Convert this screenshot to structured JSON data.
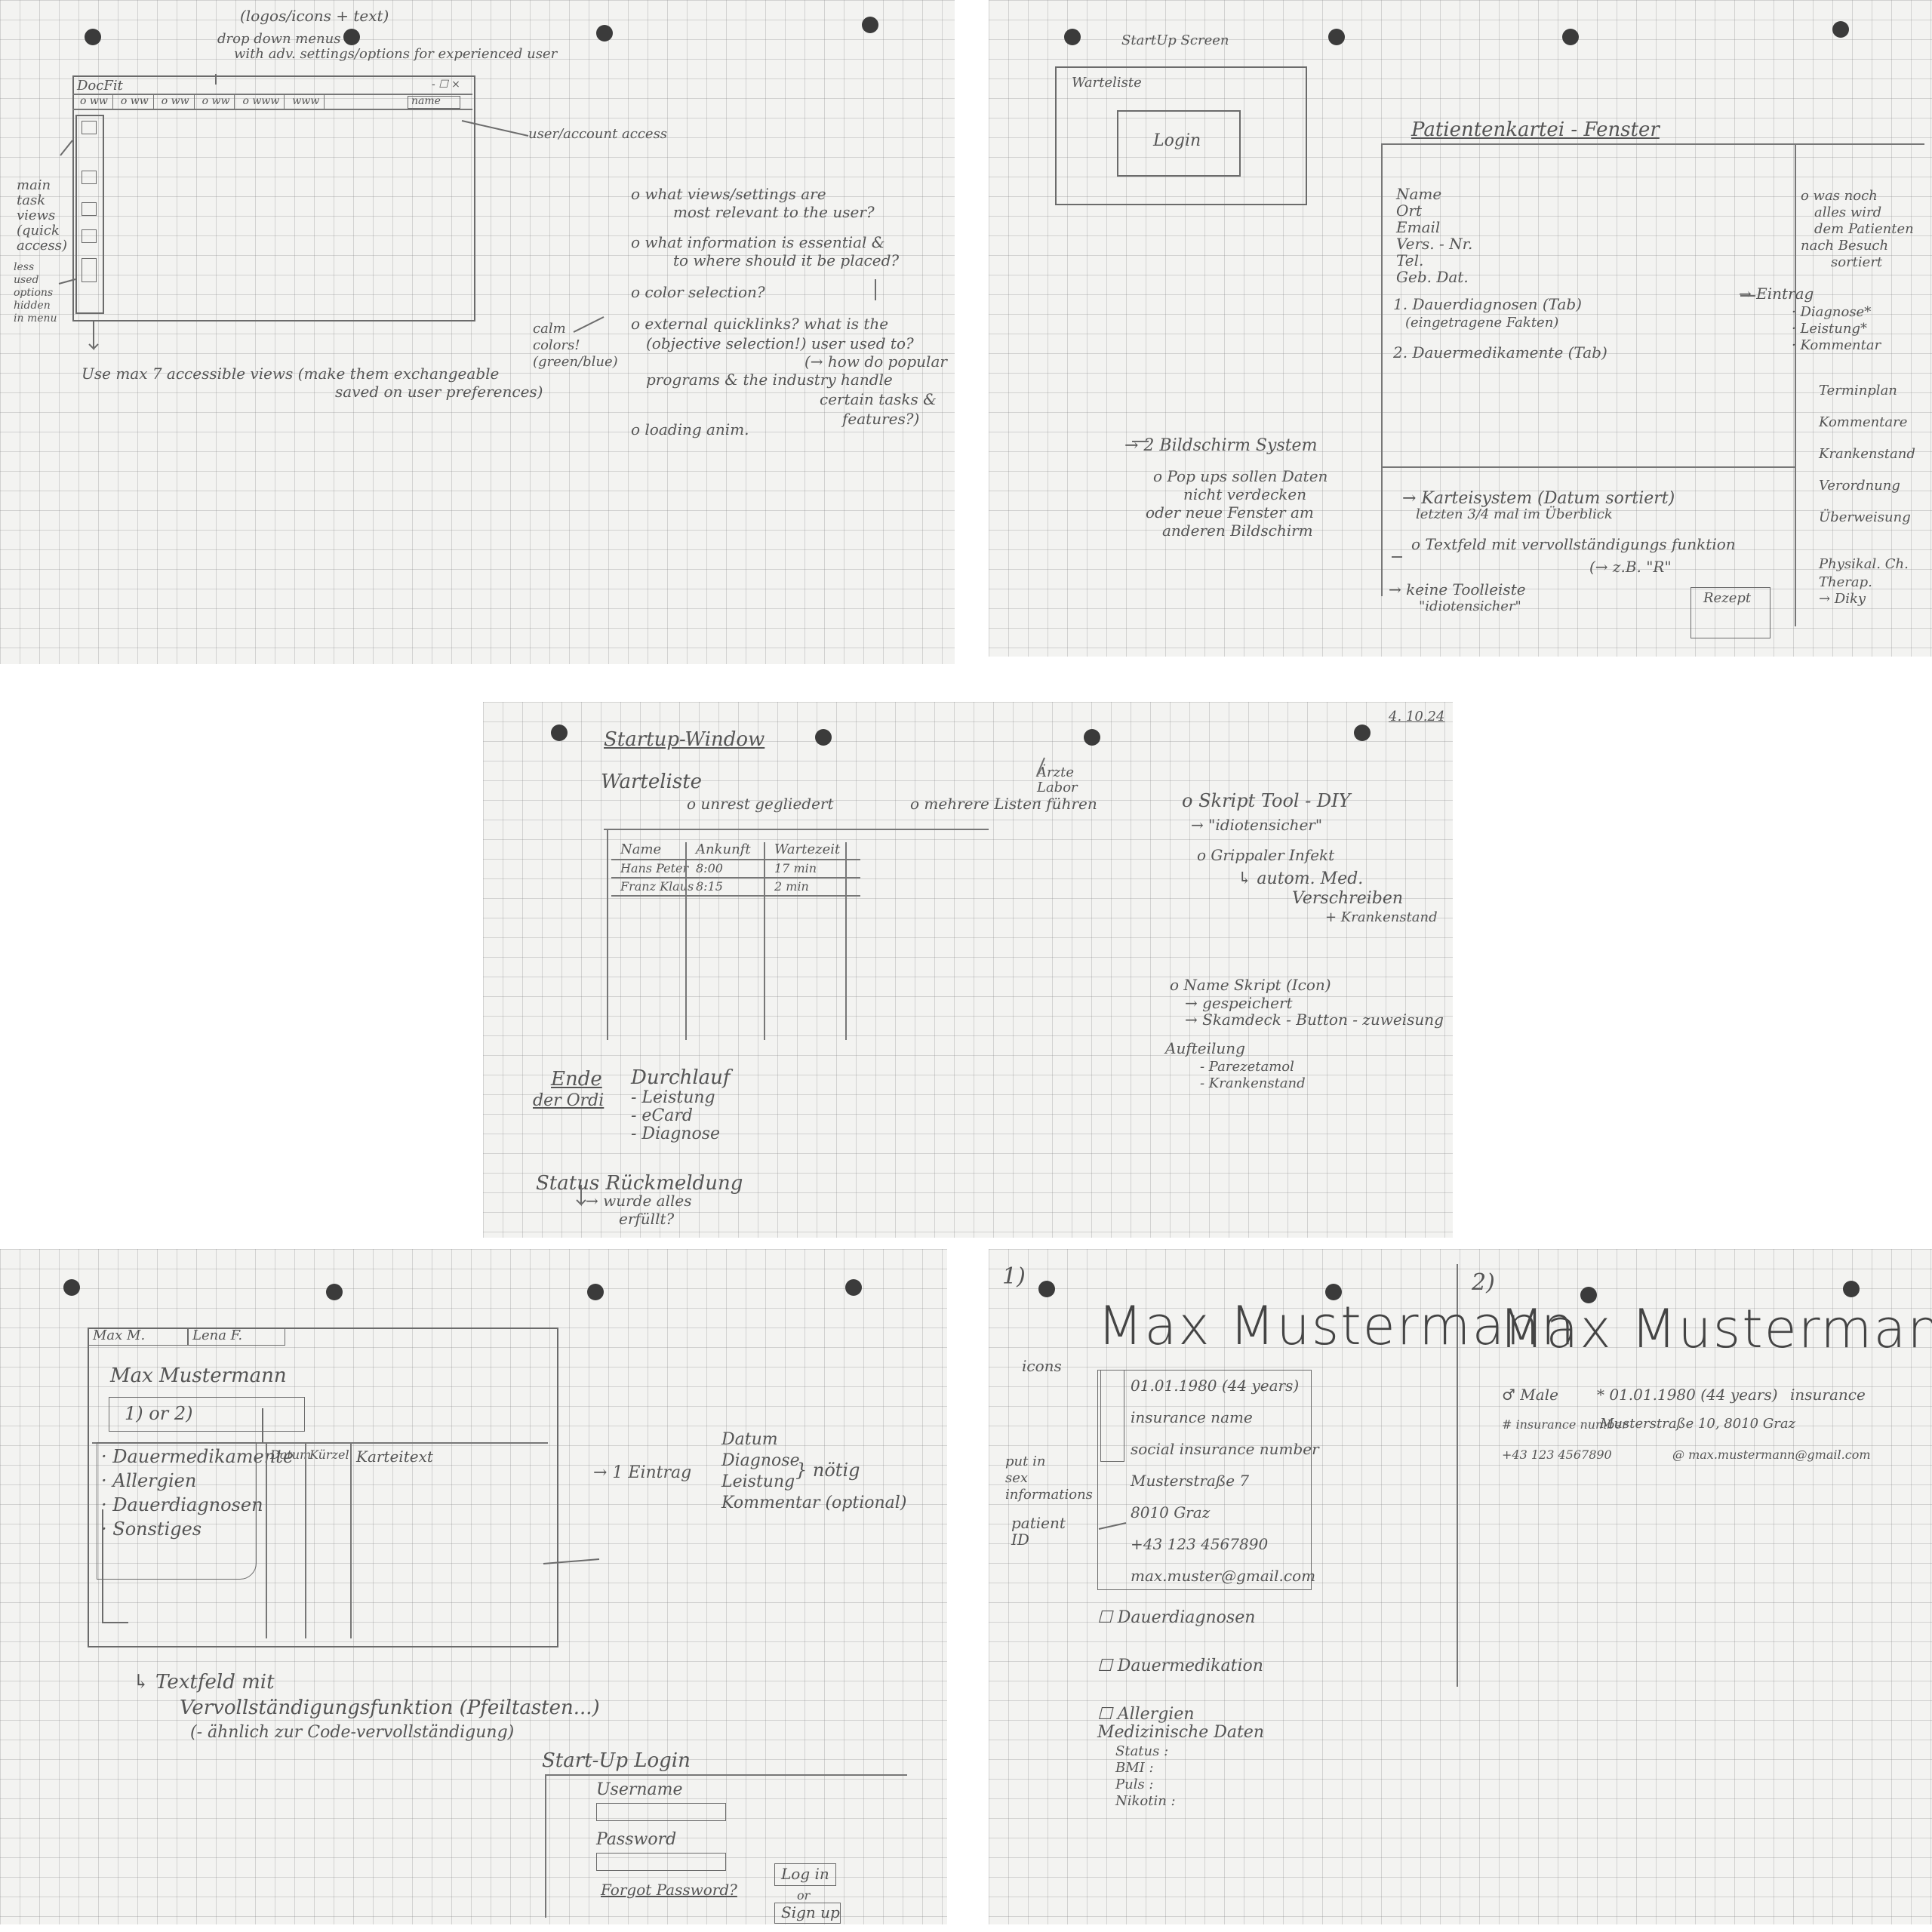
{
  "sheet1": {
    "logo_note": "(logos/icons + text)",
    "dropdown_note_1": "drop down menus",
    "dropdown_note_2": "with adv. settings/options for experienced user",
    "window_title": "DocFit",
    "window_controls": "- ☐ ×",
    "menu_items": [
      "o ww",
      "o ww",
      "o ww",
      "o ww",
      "o www",
      "www"
    ],
    "name_label": "name",
    "user_access": "user/account access",
    "side_note": [
      "main",
      "task",
      "views",
      "(quick",
      "access)"
    ],
    "less_note": [
      "less",
      "used",
      "options",
      "hidden",
      "in menu"
    ],
    "bottom_note_1": "Use max 7 accessible views (make them exchangeable",
    "bottom_note_2": "saved on user preferences)",
    "calm_note": [
      "calm",
      "colors!",
      "(green/blue)"
    ],
    "questions": [
      "o what views/settings are",
      "most relevant to the user?",
      "o what information is essential &",
      "to where should it be placed?",
      "o color selection?",
      "o external quicklinks? what is the",
      "(objective selection!) user used to?",
      "(→ how do popular",
      "programs & the industry handle",
      "certain tasks &",
      "features?)",
      "o loading anim."
    ]
  },
  "sheet2": {
    "startup": "StartUp Screen",
    "warteliste": "Warteliste",
    "login": "Login",
    "title": "Patientenkartei - Fenster",
    "fields": [
      "Name",
      "Ort",
      "Email",
      "Vers. - Nr.",
      "Tel.",
      "Geb. Dat."
    ],
    "item1": "1. Dauerdiagnosen (Tab)",
    "item1b": "(eingetragene Fakten)",
    "item2": "2. Dauermedikamente (Tab)",
    "right_notes": [
      "o was noch",
      "alles wird",
      "dem Patienten",
      "nach Besuch",
      "sortiert"
    ],
    "eintrag": "→ Eintrag",
    "eintrag_items": [
      "· Diagnose*",
      "· Leistung*",
      "· Kommentar"
    ],
    "side_list": [
      "Terminplan",
      "Kommentare",
      "Krankenstand",
      "Verordnung",
      "Überweisung",
      "Physikal. Ch.",
      "Therap.",
      "→ Diky"
    ],
    "bildschirm": "→ 2 Bildschirm System",
    "popups": [
      "o Pop ups sollen Daten",
      "nicht verdecken",
      "oder neue Fenster am",
      "anderen Bildschirm"
    ],
    "kartei": "→ Karteisystem (Datum sortiert)",
    "kartei2": "letzten 3/4 mal im Überblick",
    "textfeld": "o Textfeld mit vervollständigungs funktion",
    "textfeld2": "(→ z.B. \"R\"",
    "keine": "→ keine Toolleiste",
    "keine2": "\"idiotensicher\"",
    "rezept": "Rezept"
  },
  "sheet3": {
    "date": "4. 10.24",
    "title": "Startup-Window",
    "warteliste": "Warteliste",
    "ungegliedert": "o unrest gegliedert",
    "mehrere": "o mehrere Listen führen",
    "aerzte": [
      "Ärzte",
      "Labor",
      ":"
    ],
    "headers": [
      "Name",
      "Ankunft",
      "Wartezeit"
    ],
    "rows": [
      [
        "Hans Peter",
        "8:00",
        "17 min"
      ],
      [
        "Franz Klaus",
        "8:15",
        "2 min"
      ]
    ],
    "script_tool": "o Skript Tool - DIY",
    "idiotensicher": "→ \"idiotensicher\"",
    "grippaler": "o Grippaler Infekt",
    "grippaler2": "↳ autom. Med.",
    "grippaler3": "Verschreiben",
    "grippaler4": "+ Krankenstand",
    "name_script": "o Name Skript (Icon)",
    "gespeichert": "→ gespeichert",
    "skamdeck": "→ Skamdeck - Button - zuweisung",
    "aufteilung": "Aufteilung",
    "aufteilung_items": [
      "- Parezetamol",
      "- Krankenstand"
    ],
    "ende": "Ende",
    "der_ordi": "der Ordi",
    "durchlauf": "Durchlauf",
    "durchlauf_items": [
      "- Leistung",
      "- eCard",
      "- Diagnose"
    ],
    "status": "Status Rückmeldung",
    "status2": "→ wurde alles",
    "status3": "erfüllt?"
  },
  "sheet4": {
    "tab1": "Max M.",
    "tab2": "Lena F.",
    "patient": "Max Mustermann",
    "option": "1) or 2)",
    "list": [
      "· Dauermedikamente",
      "· Allergien",
      "· Dauerdiagnosen",
      "· Sonstiges"
    ],
    "cols": [
      "Datum",
      "Kürzel",
      "Karteitext"
    ],
    "eintrag": "→ 1 Eintrag",
    "eintrag_items": [
      "Datum",
      "Diagnose",
      "Leistung",
      "Kommentar (optional)"
    ],
    "noetig": "} nötig",
    "textfeld": "↳ Textfeld mit",
    "textfeld2": "Vervollständigungsfunktion (Pfeiltasten...)",
    "textfeld3": "(- ähnlich zur Code-vervollständigung)",
    "startup": "Start-Up Login",
    "username": "Username",
    "password": "Password",
    "forgot": "Forgot Password?",
    "login": "Log in",
    "or": "or",
    "signup": "Sign up"
  },
  "sheet5": {
    "n1": "1)",
    "n2": "2)",
    "name": "Max Mustermann",
    "icons": "icons",
    "put_in": [
      "put in",
      "sex",
      "informations"
    ],
    "patient_id": [
      "patient",
      "ID"
    ],
    "details1": [
      "01.01.1980 (44 years)",
      "insurance name",
      "social insurance number",
      "Musterstraße 7",
      "8010 Graz",
      "+43 123 4567890",
      "max.muster@gmail.com"
    ],
    "sections": [
      "☐ Dauerdiagnosen",
      "☐ Dauermedikation",
      "☐ Allergien"
    ],
    "med": "Medizinische Daten",
    "med_items": [
      "Status :",
      "BMI :",
      "Puls :",
      "Nikotin :"
    ],
    "male": "♂ Male",
    "dob": "* 01.01.1980 (44 years)",
    "insurance": "insurance",
    "ins_number": "# insurance number",
    "address": "Musterstraße 10, 8010 Graz",
    "phone": "+43 123 4567890",
    "email": "@ max.mustermann@gmail.com"
  }
}
